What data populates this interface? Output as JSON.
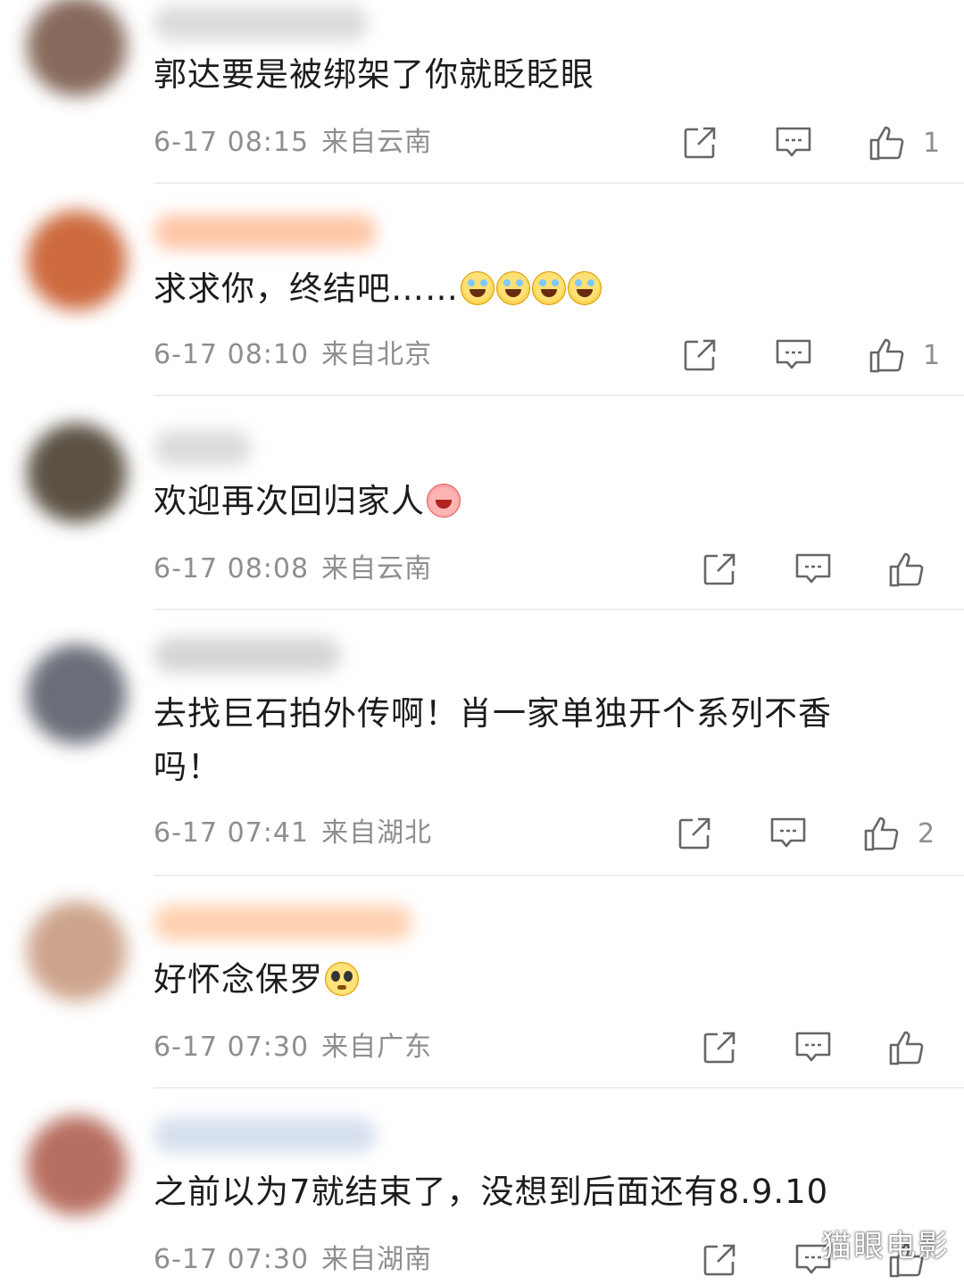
{
  "comments": [
    {
      "text": "郭达要是被绑架了你就眨眨眼",
      "emojis": [],
      "time": "6-17 08:15",
      "location": "来自云南",
      "likes": "1",
      "avatar_color": "#7a5a4a",
      "name_color": "#d8d8d8"
    },
    {
      "text": "求求你，终结吧……",
      "emojis": [
        "laugh-cry-icon",
        "laugh-cry-icon",
        "laugh-cry-icon",
        "laugh-cry-icon"
      ],
      "time": "6-17 08:10",
      "location": "来自北京",
      "likes": "1",
      "avatar_color": "#c85a2a",
      "name_color": "#ffc6a8"
    },
    {
      "text": "欢迎再次回归家人",
      "emojis": [
        "pig-laugh-icon"
      ],
      "time": "6-17 08:08",
      "location": "来自云南",
      "likes": "",
      "avatar_color": "#4a4030",
      "name_color": "#dcdcdc"
    },
    {
      "text": "去找巨石拍外传啊！肖一家单独开个系列不香吗！",
      "emojis": [],
      "time": "6-17 07:41",
      "location": "来自湖北",
      "likes": "2",
      "avatar_color": "#5a5f6a",
      "name_color": "#d6d6d6"
    },
    {
      "text": "好怀念保罗",
      "emojis": [
        "pleading-face-icon"
      ],
      "time": "6-17 07:30",
      "location": "来自广东",
      "likes": "",
      "avatar_color": "#c89a80",
      "name_color": "#ffd0b0"
    },
    {
      "text": "之前以为7就结束了，没想到后面还有8.9.10",
      "emojis": [],
      "time": "6-17 07:30",
      "location": "来自湖南",
      "likes": "",
      "avatar_color": "#b06050",
      "name_color": "#d6e0ee"
    }
  ],
  "icons": {
    "repost": "repost-icon",
    "comment": "comment-icon",
    "like": "thumbs-up-icon"
  },
  "watermark": "猫眼电影"
}
